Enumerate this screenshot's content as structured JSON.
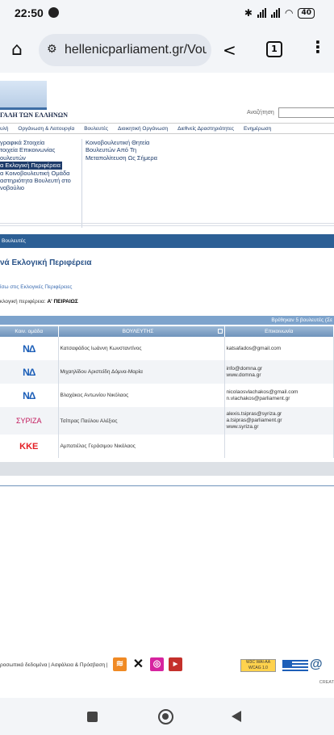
{
  "status": {
    "time": "22:50",
    "battery": "40"
  },
  "browser": {
    "url": "hellenicparliament.gr/Vou",
    "tab_count": "1"
  },
  "site": {
    "logo_text": "ΓΑΛΗ ΤΩΝ ΕΛΛΗΝΩΝ",
    "search_label": "Αναζήτηση",
    "nav": [
      "υλή",
      "Οργάνωση & Λειτουργία",
      "Βουλευτές",
      "Διοικητική Οργάνωση",
      "Διεθνείς Δραστηριότητες",
      "Ενημέρωση"
    ]
  },
  "left_menu": [
    "γραφικά Στοιχεία",
    "τοιχεία Επικοινωνίας",
    "ουλευτών",
    "α Εκλογική Περιφέρεια",
    "α Κοινοβουλευτική Ομάδα",
    "αστηριότητα Βουλευτή στο",
    "νοβούλιο"
  ],
  "right_menu": [
    "Κοινοβουλευτική Θητεία",
    "Βουλευτών Από Τη",
    "Μεταπολίτευση Ως Σήμερα"
  ],
  "section_bar": "Βουλευτές",
  "page_title": "νά Εκλογική Περιφέρεια",
  "back_link": "ίσω στις Εκλογικές Περιφέρειες",
  "region": {
    "label": "κλογική περιφέρεια:",
    "value": "Α' ΠΕΙΡΑΙΩΣ"
  },
  "found_text": "Βρέθηκαν 5 βουλευτές (Σε",
  "table": {
    "headers": [
      "Κοιν. ομάδα",
      "ΒΟΥΛΕΥΤΗΣ",
      "Επικοινωνία"
    ],
    "rows": [
      {
        "party": "ΝΔ",
        "name": "Κατσαφάδος Ιωάννη Κωνσταντίνος",
        "contact": [
          "katsafados@gmail.com"
        ]
      },
      {
        "party": "ΝΔ",
        "name": "Μιχαηλίδου Αριστείδη Δόμνα-Μαρία",
        "contact": [
          "info@domna.gr",
          "www.domna.gr"
        ]
      },
      {
        "party": "ΝΔ",
        "name": "Βλαχάκος Αντωνίου Νικόλαος",
        "contact": [
          "nicolaosvlachakos@gmail.com",
          "n.vlachakos@parliament.gr"
        ]
      },
      {
        "party": "ΣΥΡΙΖΑ",
        "name": "Τσίπρας Παύλου Αλέξιος",
        "contact": [
          "alexis.tsipras@syriza.gr",
          "a.tsipras@parliament.gr",
          "www.syriza.gr"
        ]
      },
      {
        "party": "ΚΚΕ",
        "name": "Αμπατιέλος Γεράσιμου Νικόλαος",
        "contact": []
      }
    ]
  },
  "footer": {
    "links": "ροσωπικά δεδομένα | Ασφάλεια & Πρόσβαση |",
    "wai": "W3C WAI-AA WCAG 1.0",
    "credit": "CREAT"
  },
  "colors": {
    "nd": "#1d5fb8",
    "syriza": "#c2185b",
    "kke": "#e31e24",
    "primary": "#2c5f95"
  }
}
